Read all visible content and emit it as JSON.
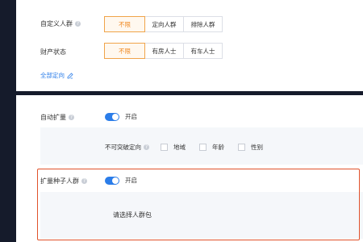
{
  "targeting": {
    "custom_audience": {
      "label": "自定义人群",
      "options": [
        "不限",
        "定向人群",
        "排除人群"
      ],
      "selected": "不限"
    },
    "asset_status": {
      "label": "财产状态",
      "options": [
        "不限",
        "有房人士",
        "有车人士"
      ],
      "selected": "不限"
    },
    "all_targeting_link": "全部定向"
  },
  "auto_expand": {
    "label": "自动扩量",
    "toggle_label": "开启",
    "toggle_on": true,
    "unbreakable_label": "不可突破定向",
    "checkboxes": [
      "地域",
      "年龄",
      "性别"
    ]
  },
  "seed_expand": {
    "label": "扩量种子人群",
    "toggle_label": "开启",
    "toggle_on": true,
    "select_prompt": "请选择人群包"
  },
  "colors": {
    "accent": "#f08a24",
    "link": "#2b7de9",
    "highlight_border": "#e0512a",
    "background": "#151b2b"
  }
}
